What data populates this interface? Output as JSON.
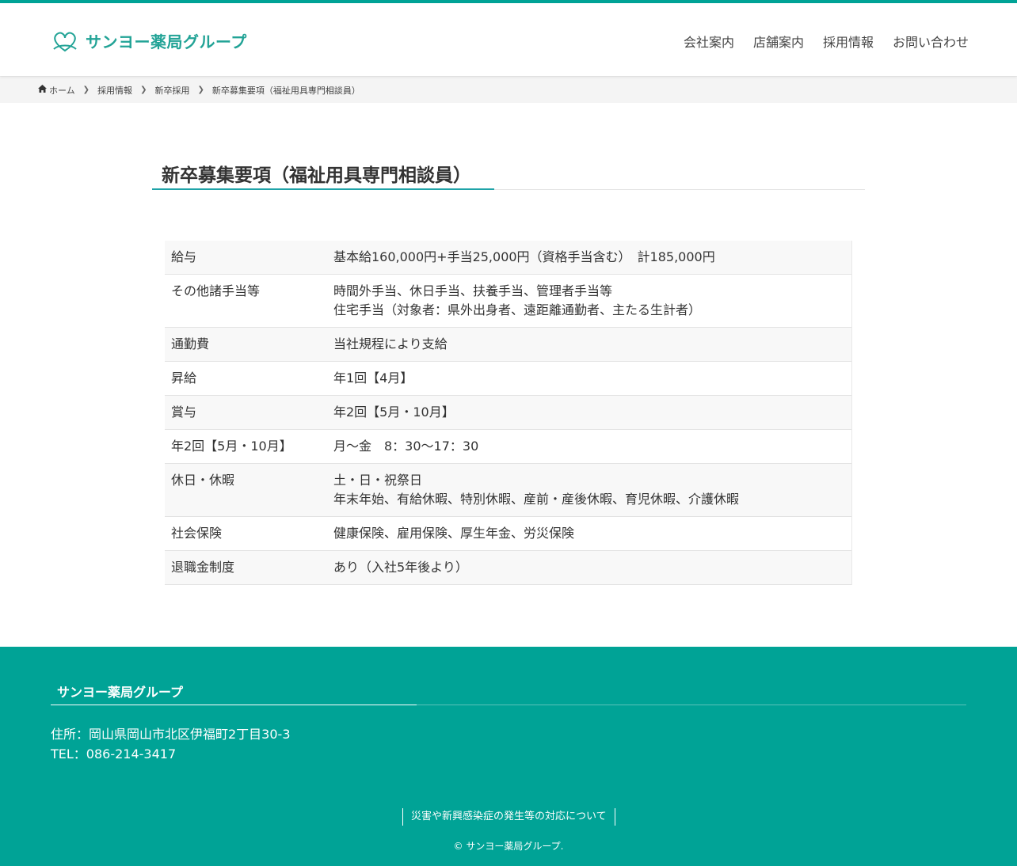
{
  "colors": {
    "accent": "#00a396",
    "logo_text": "#22a396",
    "title_underline": "#1fa3a8"
  },
  "header": {
    "logo": {
      "icon": "heart-ribbon-icon",
      "text": "サンヨー薬局グループ"
    },
    "nav": [
      {
        "label": "会社案内"
      },
      {
        "label": "店舗案内"
      },
      {
        "label": "採用情報"
      },
      {
        "label": "お問い合わせ"
      }
    ]
  },
  "breadcrumb": {
    "home_icon": "home-icon",
    "items": [
      "ホーム",
      "採用情報",
      "新卒採用",
      "新卒募集要項（福祉用具専門相談員）"
    ]
  },
  "page": {
    "title": "新卒募集要項（福祉用具専門相談員）"
  },
  "table": {
    "rows": [
      {
        "label": "給与",
        "lines": [
          "基本給160,000円+手当25,000円（資格手当含む）　計185,000円"
        ]
      },
      {
        "label": "その他諸手当等",
        "lines": [
          "時間外手当、休日手当、扶養手当、管理者手当等",
          "住宅手当（対象者：県外出身者、遠距離通勤者、主たる生計者）"
        ]
      },
      {
        "label": "通勤費",
        "lines": [
          "当社規程により支給"
        ]
      },
      {
        "label": "昇給",
        "lines": [
          "年1回【4月】"
        ]
      },
      {
        "label": "賞与",
        "lines": [
          "年2回【5月・10月】"
        ]
      },
      {
        "label": "年2回【5月・10月】",
        "lines": [
          "月～金　8：30～17：30"
        ]
      },
      {
        "label": "休日・休暇",
        "lines": [
          "土・日・祝祭日",
          "年末年始、有給休暇、特別休暇、産前・産後休暇、育児休暇、介護休暇"
        ]
      },
      {
        "label": "社会保険",
        "lines": [
          "健康保険、雇用保険、厚生年金、労災保険"
        ]
      },
      {
        "label": "退職金制度",
        "lines": [
          "あり（入社5年後より）"
        ]
      }
    ]
  },
  "footer": {
    "heading": "サンヨー薬局グループ",
    "address": "住所：岡山県岡山市北区伊福町2丁目30-3",
    "tel": "TEL：086-214-3417",
    "link": "災害や新興感染症の発生等の対応について",
    "copyright": "© サンヨー薬局グループ."
  }
}
